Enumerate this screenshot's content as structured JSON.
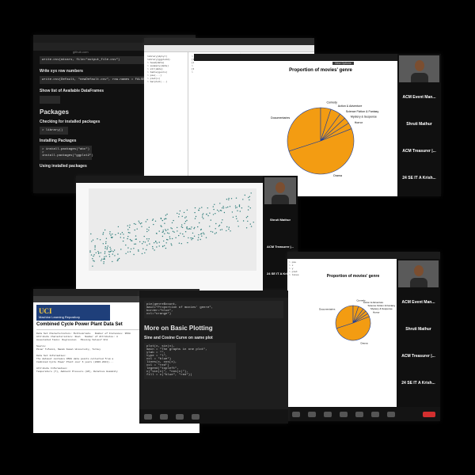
{
  "collage": {
    "s1": {
      "tab_title": "Rmarkdown",
      "url": "github.com",
      "code_lines": [
        "write.csv(mtcars, file=\"output_file.csv\")",
        "write.csv(Default, \"newDefault.csv\", row.names = FALSE)"
      ],
      "heading_write": "Write xyx row numbers",
      "heading_list": "Show list of Available DataFrames",
      "h_packages": "Packages",
      "checking": "Checking for installed packages",
      "installed_code": "> library()",
      "installing": "Installing Packages",
      "install_code": [
        "> install.packages(\"abc\")",
        "> install.packages(\"ggplot2\")"
      ],
      "using": "Using installed packages"
    },
    "s2": {
      "view_options": "View Options",
      "chart_title": "Proportion of movies' genre"
    },
    "s4": {
      "view_options": "View Options",
      "chart_title": "Proportion of movies' genre"
    },
    "s5": {
      "repo_brand": "UCI",
      "repo_name": "Machine Learning Repository",
      "page_title": "Combined Cycle Power Plant Data Set"
    },
    "s6": {
      "heading": "More on Basic Plotting",
      "subheading": "Sine and Cosine Curve on same plot",
      "code_top": [
        "pie(genre$count,",
        "    main=\"Proportion of movies' genre\",",
        "    border=\"blue\",",
        "    col=\"orange\")"
      ],
      "code_main": [
        "plot(x, sin(x),",
        "     main = \"The graphs in one plot\",",
        "     ylab = \"\",",
        "     type = \"l\",",
        "     col = \"blue\")",
        "lines(x, cos(x),",
        "      col = \"red\")",
        "legend(\"topleft\",",
        "       c(\"sin(x)\", \"cos(x)\"),",
        "       fill = c(\"blue\", \"red\"))"
      ]
    }
  },
  "participants": {
    "list": [
      "ACM Event Man...",
      "Shruti Mathur",
      "ACM Treasurer |...",
      "24 SE IT A Krish..."
    ]
  },
  "chart_data": [
    {
      "type": "pie",
      "title": "Proportion of movies' genre",
      "categories": [
        "Documentaries",
        "Comedy",
        "Action & Adventure",
        "Science Fiction & Fantasy",
        "Mystery & Suspense",
        "Horror",
        "Drama"
      ],
      "values": [
        30,
        5,
        5,
        3,
        3,
        3,
        51
      ]
    }
  ],
  "colors": {
    "pie_fill": "#f39c12",
    "pie_stroke": "#1a3f9e",
    "scatter": "#2e7d7a"
  }
}
